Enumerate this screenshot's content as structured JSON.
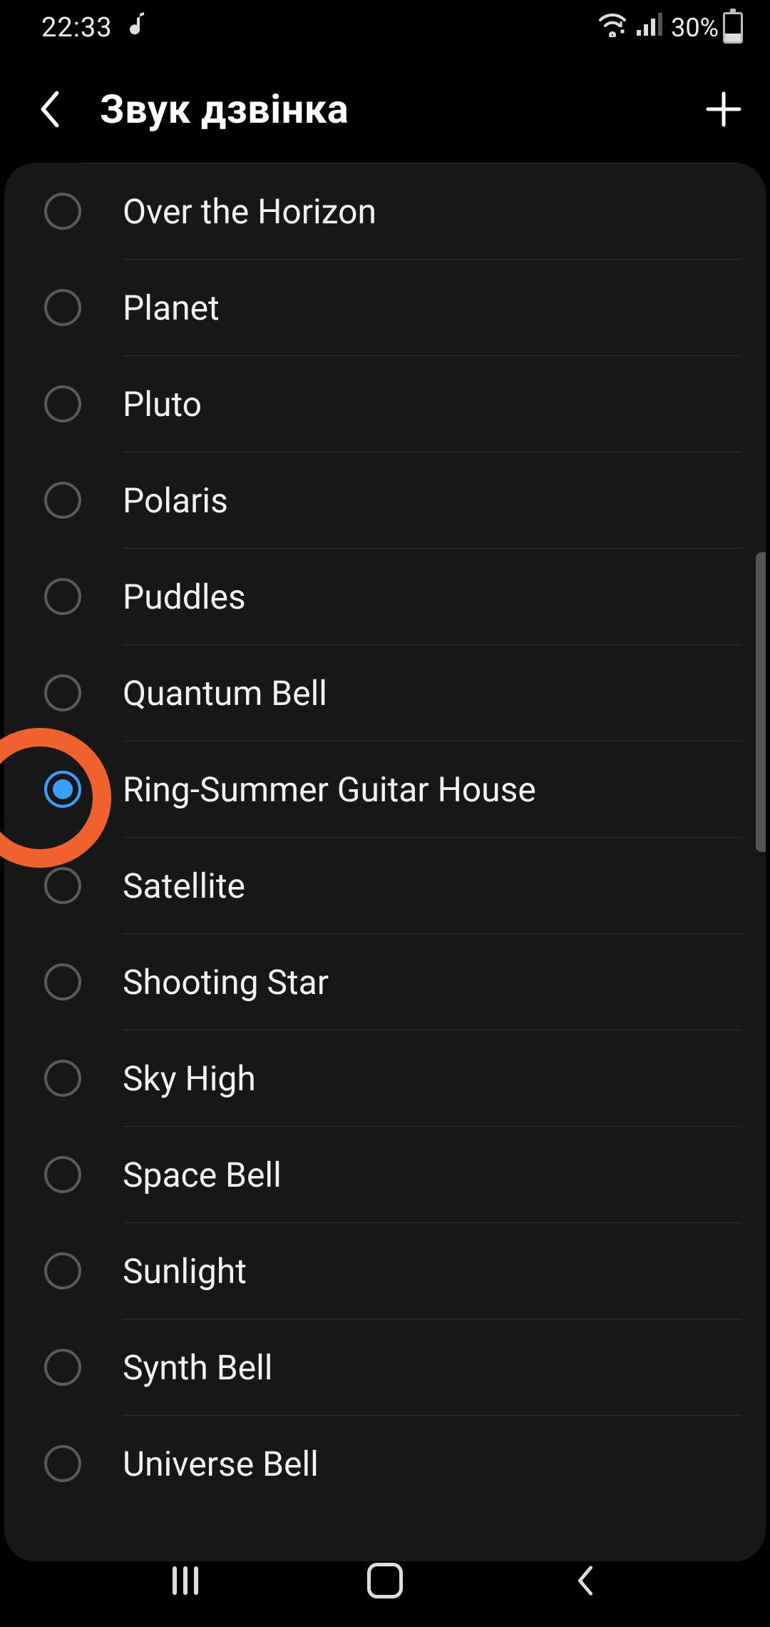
{
  "status": {
    "time": "22:33",
    "battery_pct": "30%"
  },
  "header": {
    "title": "Звук дзвінка"
  },
  "ringtones": [
    {
      "name": "Over the Horizon",
      "selected": false
    },
    {
      "name": "Planet",
      "selected": false
    },
    {
      "name": "Pluto",
      "selected": false
    },
    {
      "name": "Polaris",
      "selected": false
    },
    {
      "name": "Puddles",
      "selected": false
    },
    {
      "name": "Quantum Bell",
      "selected": false
    },
    {
      "name": "Ring-Summer Guitar House",
      "selected": true
    },
    {
      "name": "Satellite",
      "selected": false
    },
    {
      "name": "Shooting Star",
      "selected": false
    },
    {
      "name": "Sky High",
      "selected": false
    },
    {
      "name": "Space Bell",
      "selected": false
    },
    {
      "name": "Sunlight",
      "selected": false
    },
    {
      "name": "Synth Bell",
      "selected": false
    },
    {
      "name": "Universe Bell",
      "selected": false
    }
  ]
}
